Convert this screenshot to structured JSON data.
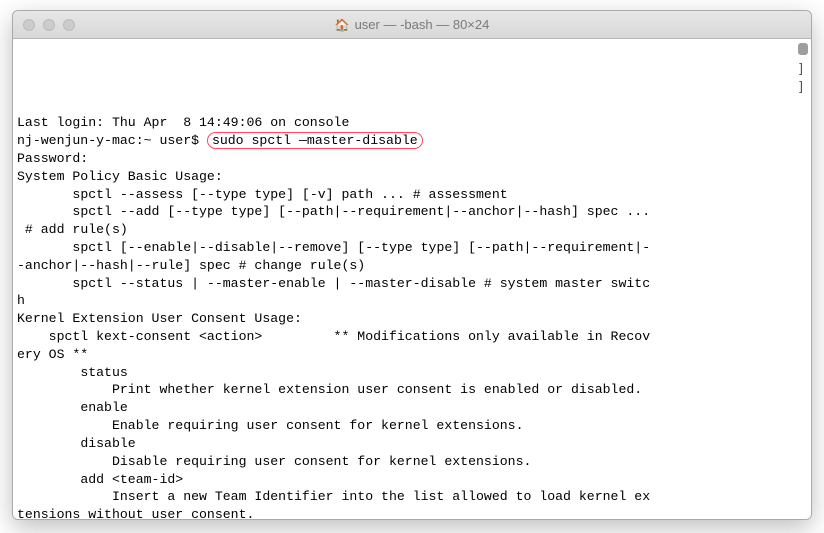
{
  "titlebar": {
    "icon": "🏠",
    "title": "user — -bash — 80×24"
  },
  "terminal": {
    "lines": {
      "login": "Last login: Thu Apr  8 14:49:06 on console",
      "prompt_prefix": "nj-wenjun-y-mac:~ user$ ",
      "highlighted_cmd": "sudo spctl —master-disable",
      "password": "Password:",
      "usage_header": "System Policy Basic Usage:",
      "usage1": "       spctl --assess [--type type] [-v] path ... # assessment",
      "usage2": "       spctl --add [--type type] [--path|--requirement|--anchor|--hash] spec ...",
      "usage2b": " # add rule(s)",
      "usage3": "       spctl [--enable|--disable|--remove] [--type type] [--path|--requirement|-",
      "usage3b": "-anchor|--hash|--rule] spec # change rule(s)",
      "usage4": "       spctl --status | --master-enable | --master-disable # system master switc",
      "usage4b": "h",
      "blank": "",
      "kext_header": "Kernel Extension User Consent Usage:",
      "kext1": "    spctl kext-consent <action>         ** Modifications only available in Recov",
      "kext1b": "ery OS **",
      "kext2": "        status",
      "kext3": "            Print whether kernel extension user consent is enabled or disabled.",
      "kext4": "        enable",
      "kext5": "            Enable requiring user consent for kernel extensions.",
      "kext6": "        disable",
      "kext7": "            Disable requiring user consent for kernel extensions.",
      "kext8": "        add <team-id>",
      "kext9": "            Insert a new Team Identifier into the list allowed to load kernel ex",
      "kext9b": "tensions without user consent."
    }
  }
}
